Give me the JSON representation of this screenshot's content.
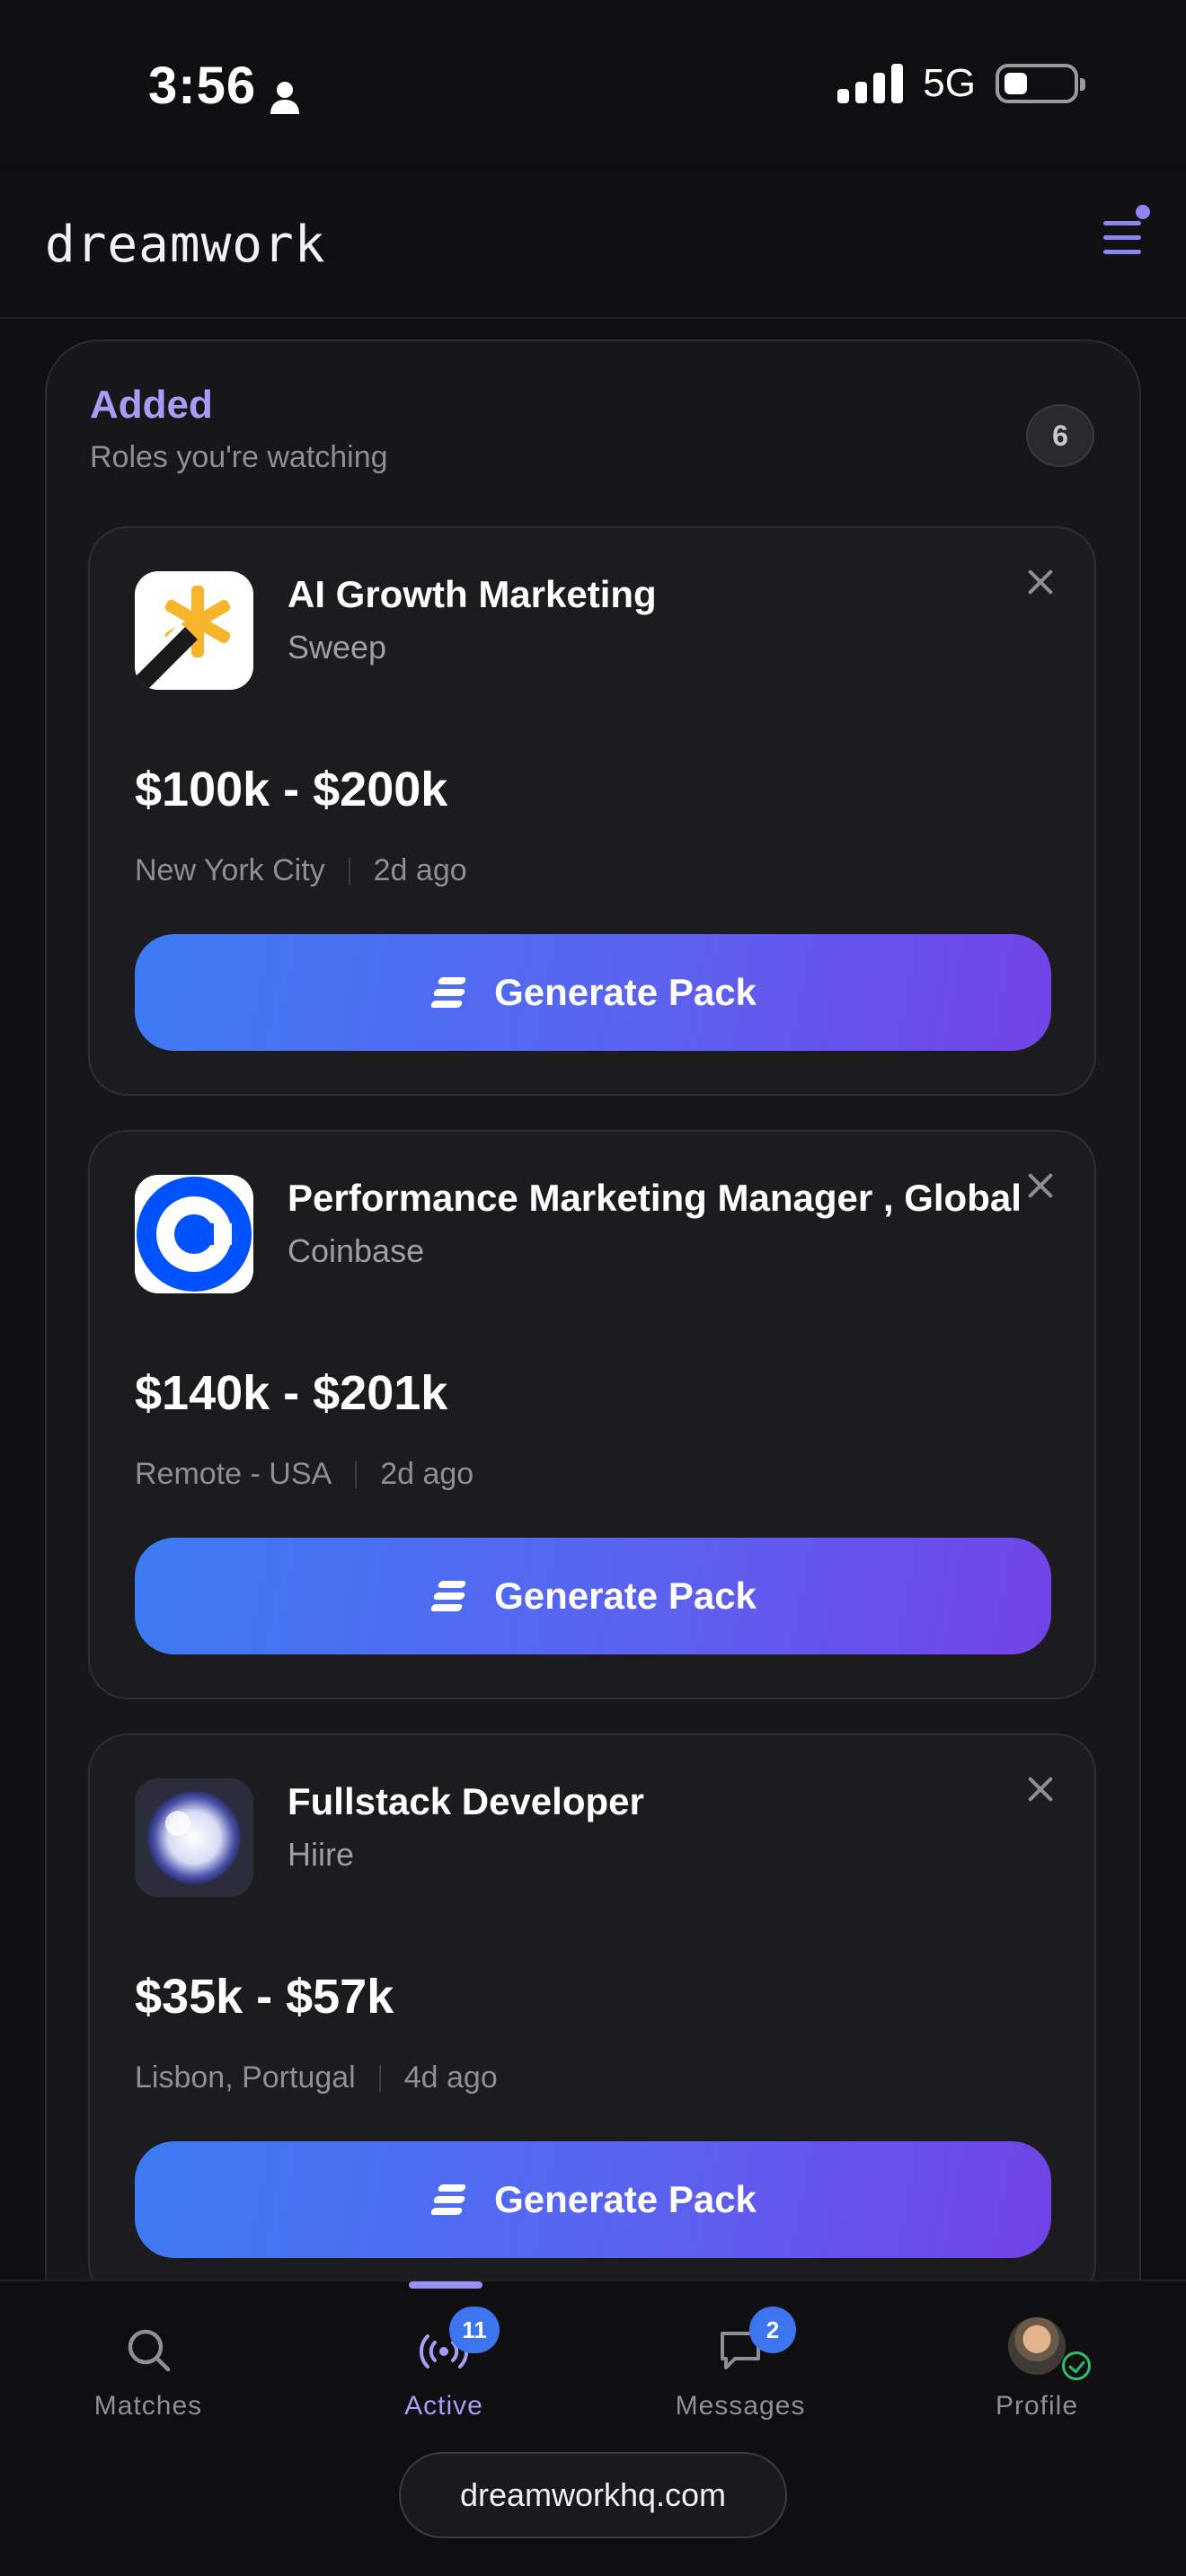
{
  "status_bar": {
    "time": "3:56",
    "network": "5G",
    "battery_level": 0.35
  },
  "header": {
    "logo": "dreamwork",
    "menu_icon": "hamburger-menu-icon"
  },
  "section": {
    "title": "Added",
    "subtitle": "Roles you're watching",
    "count": "6"
  },
  "jobs": [
    {
      "title": "AI Growth Marketing",
      "company": "Sweep",
      "salary": "$100k - $200k",
      "location": "New York City",
      "posted": "2d ago",
      "action": "Generate Pack",
      "logo_icon": "sweep-logo"
    },
    {
      "title": "Performance Marketing Manager , Global",
      "company": "Coinbase",
      "salary": "$140k - $201k",
      "location": "Remote - USA",
      "posted": "2d ago",
      "action": "Generate Pack",
      "logo_icon": "coinbase-logo"
    },
    {
      "title": "Fullstack Developer",
      "company": "Hiire",
      "salary": "$35k - $57k",
      "location": "Lisbon, Portugal",
      "posted": "4d ago",
      "action": "Generate Pack",
      "logo_icon": "hiire-logo"
    }
  ],
  "tab_bar": {
    "tabs": [
      {
        "label": "Matches",
        "icon": "search-icon"
      },
      {
        "label": "Active",
        "icon": "broadcast-icon",
        "badge": "11"
      },
      {
        "label": "Messages",
        "icon": "chat-icon",
        "badge": "2"
      },
      {
        "label": "Profile",
        "icon": "avatar"
      }
    ]
  },
  "browser": {
    "url": "dreamworkhq.com"
  },
  "colors": {
    "accent": "#a99cf6",
    "button_gradient_start": "#3d7bf4",
    "button_gradient_end": "#7243e8",
    "badge": "#3d74f0",
    "background": "#0f0f11"
  }
}
